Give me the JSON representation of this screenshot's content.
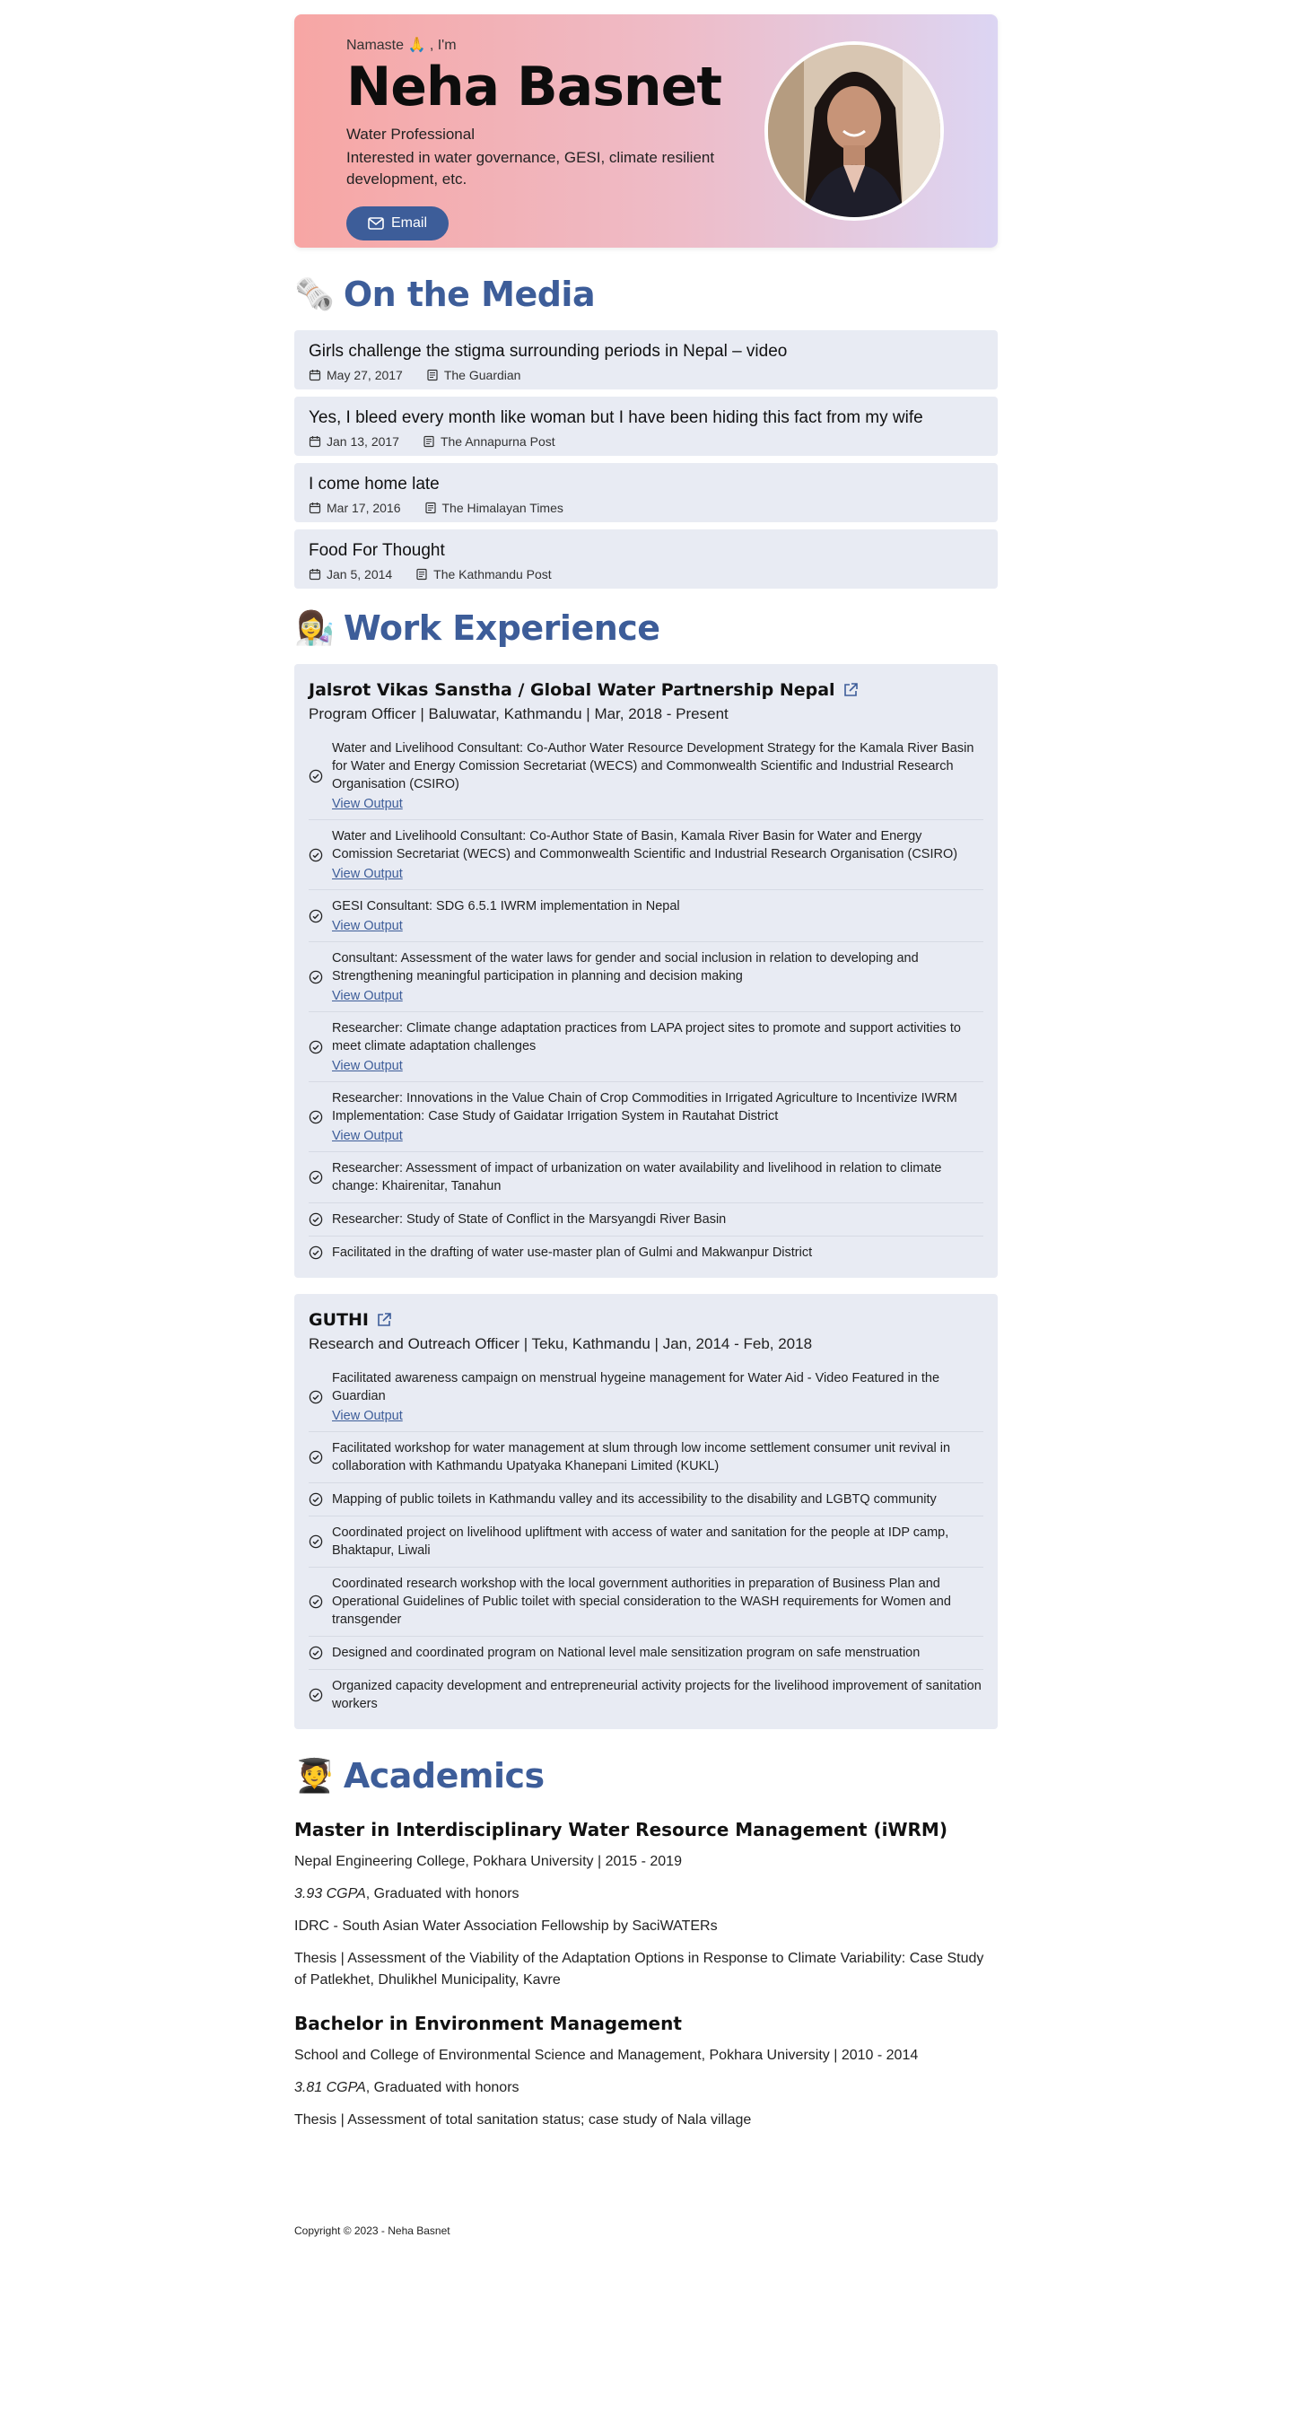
{
  "hero": {
    "greeting": "Namaste 🙏 , I'm",
    "name": "Neha Basnet",
    "role": "Water Professional",
    "interest": "Interested in water governance, GESI, climate resilient development, etc.",
    "email_label": "Email"
  },
  "media": {
    "emoji": "🗞️",
    "title": "On the Media",
    "items": [
      {
        "title": "Girls challenge the stigma surrounding periods in Nepal – video",
        "date": "May 27, 2017",
        "source": "The Guardian"
      },
      {
        "title": "Yes, I bleed every month like woman but I have been hiding this fact from my wife",
        "date": "Jan 13, 2017",
        "source": "The Annapurna Post"
      },
      {
        "title": "I come home late",
        "date": "Mar 17, 2016",
        "source": "The Himalayan Times"
      },
      {
        "title": "Food For Thought",
        "date": "Jan 5, 2014",
        "source": "The Kathmandu Post"
      }
    ]
  },
  "work": {
    "emoji": "👩‍🔬",
    "title": "Work Experience",
    "jobs": [
      {
        "org": "Jalsrot Vikas Sanstha / Global Water Partnership Nepal",
        "position": "Program Officer | Baluwatar, Kathmandu | Mar, 2018 - Present",
        "items": [
          {
            "text": "Water and Livelihood Consultant: Co-Author Water Resource Development Strategy for the Kamala River Basin for Water and Energy Comission Secretariat (WECS) and Commonwealth Scientific and Industrial Research Organisation (CSIRO)",
            "link": "View Output"
          },
          {
            "text": "Water and Livelihoold Consultant: Co-Author State of Basin, Kamala River Basin for Water and Energy Comission Secretariat (WECS) and Commonwealth Scientific and Industrial Research Organisation (CSIRO)",
            "link": "View Output"
          },
          {
            "text": "GESI Consultant: SDG 6.5.1 IWRM implementation in Nepal",
            "link": "View Output"
          },
          {
            "text": "Consultant: Assessment of the water laws for gender and social inclusion in relation to developing and Strengthening meaningful participation in planning and decision making",
            "link": "View Output"
          },
          {
            "text": "Researcher: Climate change adaptation practices from LAPA project sites to promote and support activities to meet climate adaptation challenges",
            "link": "View Output"
          },
          {
            "text": "Researcher: Innovations in the Value Chain of Crop Commodities in Irrigated Agriculture to Incentivize IWRM Implementation: Case Study of Gaidatar Irrigation System in Rautahat District",
            "link": "View Output"
          },
          {
            "text": "Researcher: Assessment of impact of urbanization on water availability and livelihood in relation to climate change: Khairenitar, Tanahun",
            "link": ""
          },
          {
            "text": "Researcher: Study of State of Conflict in the Marsyangdi River Basin",
            "link": ""
          },
          {
            "text": "Facilitated in the drafting of water use-master plan of Gulmi and Makwanpur District",
            "link": ""
          }
        ]
      },
      {
        "org": "GUTHI",
        "position": "Research and Outreach Officer | Teku, Kathmandu | Jan, 2014 - Feb, 2018",
        "items": [
          {
            "text": "Facilitated awareness campaign on menstrual hygeine management for Water Aid - Video Featured in the Guardian",
            "link": "View Output"
          },
          {
            "text": "Facilitated workshop for water management at slum through low income settlement consumer unit revival in collaboration with Kathmandu Upatyaka Khanepani Limited (KUKL)",
            "link": ""
          },
          {
            "text": "Mapping of public toilets in Kathmandu valley and its accessibility to the disability and LGBTQ community",
            "link": ""
          },
          {
            "text": "Coordinated project on livelihood upliftment with access of water and sanitation for the people at IDP camp, Bhaktapur, Liwali",
            "link": ""
          },
          {
            "text": "Coordinated research workshop with the local government authorities in preparation of Business Plan and Operational Guidelines of Public toilet with special consideration to the WASH requirements for Women and transgender",
            "link": ""
          },
          {
            "text": "Designed and coordinated program on National level male sensitization program on safe menstruation",
            "link": ""
          },
          {
            "text": "Organized capacity development and entrepreneurial activity projects for the livelihood improvement of sanitation workers",
            "link": ""
          }
        ]
      }
    ]
  },
  "academics": {
    "emoji": "🧑‍🎓",
    "title": "Academics",
    "master": {
      "degree": "Master in Interdisciplinary Water Resource Management (iWRM)",
      "school": "Nepal Engineering College, Pokhara University | 2015 - 2019",
      "cgpa": "3.93 CGPA",
      "cgpa_rest": ", Graduated with honors",
      "fellowship": "IDRC - South Asian Water Association Fellowship by SaciWATERs",
      "thesis": "Thesis | Assessment of the Viability of the Adaptation Options in Response to Climate Variability: Case Study of Patlekhet, Dhulikhel Municipality, Kavre"
    },
    "bachelor": {
      "degree": "Bachelor in Environment Management",
      "school": "School and College of Environmental Science and Management, Pokhara University | 2010 - 2014",
      "cgpa": "3.81 CGPA",
      "cgpa_rest": ", Graduated with honors",
      "thesis": "Thesis | Assessment of total sanitation status; case study of Nala village"
    }
  },
  "footer": {
    "copyright": "Copyright © 2023 - Neha Basnet"
  },
  "colors": {
    "accent": "#3d5d99",
    "card": "#e8ebf3"
  }
}
